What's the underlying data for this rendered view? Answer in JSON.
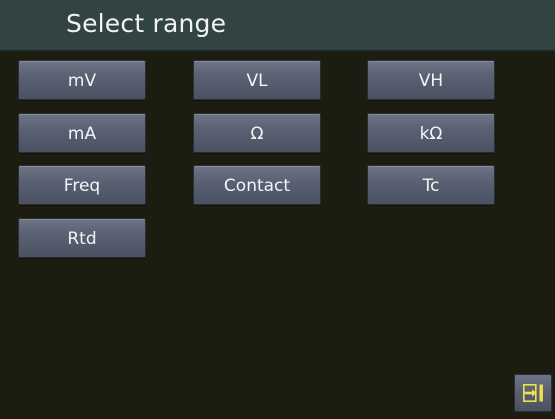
{
  "header": {
    "title": "Select range"
  },
  "ranges": [
    {
      "label": "mV"
    },
    {
      "label": "VL"
    },
    {
      "label": "VH"
    },
    {
      "label": "mA"
    },
    {
      "label": "Ω"
    },
    {
      "label": "kΩ"
    },
    {
      "label": "Freq"
    },
    {
      "label": "Contact"
    },
    {
      "label": "Tc"
    },
    {
      "label": "Rtd"
    }
  ],
  "footer": {
    "exit_icon": "exit-icon"
  },
  "colors": {
    "header_bg": "#314441",
    "screen_bg": "#1d1c10",
    "button_bg": "#596173",
    "exit_icon": "#f1e24a"
  }
}
